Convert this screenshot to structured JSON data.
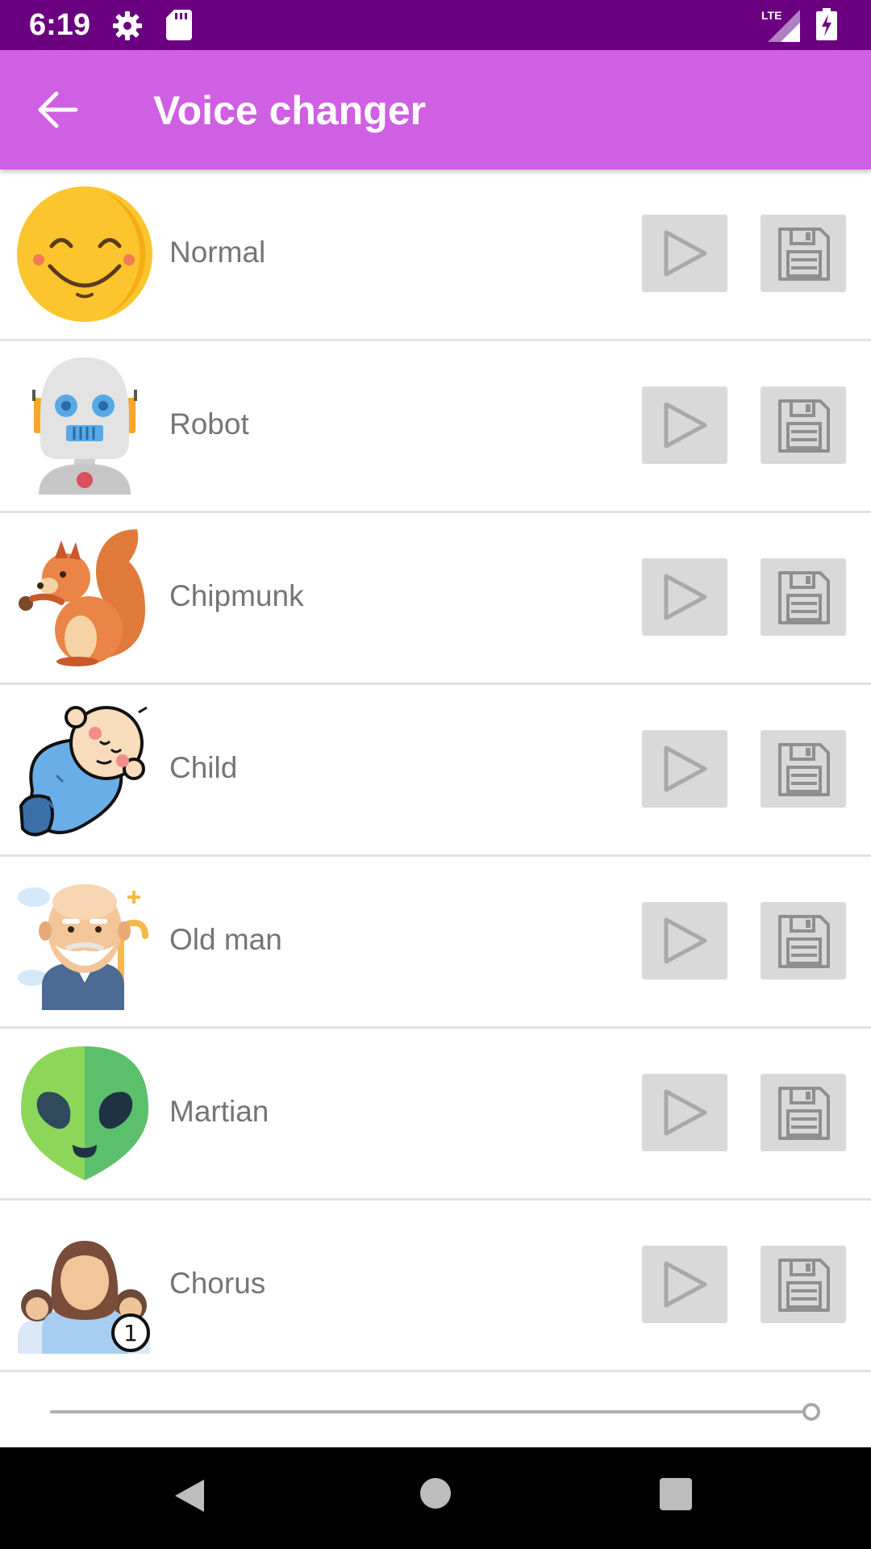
{
  "status_bar": {
    "time": "6:19",
    "network": "LTE",
    "icons": [
      "settings-icon",
      "sd-card-icon",
      "lte-signal-icon",
      "battery-charging-icon"
    ]
  },
  "app_bar": {
    "title": "Voice changer",
    "back_icon": "arrow-back-icon",
    "background": "#cf5fe3",
    "status_background": "#6a0080"
  },
  "voices": [
    {
      "label": "Normal",
      "avatar": "smiley-face-icon"
    },
    {
      "label": "Robot",
      "avatar": "robot-icon"
    },
    {
      "label": "Chipmunk",
      "avatar": "squirrel-icon"
    },
    {
      "label": "Child",
      "avatar": "baby-icon"
    },
    {
      "label": "Old man",
      "avatar": "old-man-icon"
    },
    {
      "label": "Martian",
      "avatar": "alien-icon"
    },
    {
      "label": "Chorus",
      "avatar": "chorus-group-icon",
      "badge": "1"
    }
  ],
  "row_actions": {
    "play_icon": "play-icon",
    "save_icon": "floppy-disk-icon"
  },
  "playback": {
    "progress_fraction": 1.0
  },
  "nav_bar": {
    "icons": [
      "nav-back-icon",
      "nav-home-icon",
      "nav-recents-icon"
    ]
  }
}
